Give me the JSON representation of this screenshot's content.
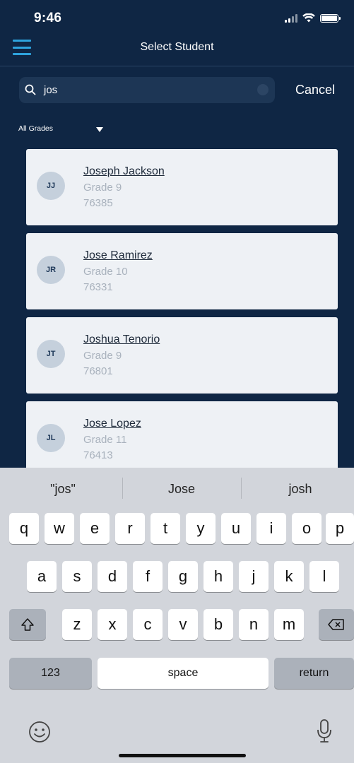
{
  "status_bar": {
    "time": "9:46"
  },
  "nav": {
    "title": "Select Student"
  },
  "search": {
    "value": "jos",
    "cancel_label": "Cancel"
  },
  "filter": {
    "label": "All Grades"
  },
  "students": [
    {
      "initials": "JJ",
      "name": "Joseph Jackson",
      "grade": "Grade 9",
      "id": "76385"
    },
    {
      "initials": "JR",
      "name": "Jose Ramirez",
      "grade": "Grade 10",
      "id": "76331"
    },
    {
      "initials": "JT",
      "name": "Joshua Tenorio",
      "grade": "Grade 9",
      "id": "76801"
    },
    {
      "initials": "JL",
      "name": "Jose Lopez",
      "grade": "Grade 11",
      "id": "76413"
    }
  ],
  "keyboard": {
    "suggestions": [
      "\"jos\"",
      "Jose",
      "josh"
    ],
    "row1": [
      "q",
      "w",
      "e",
      "r",
      "t",
      "y",
      "u",
      "i",
      "o",
      "p"
    ],
    "row2": [
      "a",
      "s",
      "d",
      "f",
      "g",
      "h",
      "j",
      "k",
      "l"
    ],
    "row3": [
      "z",
      "x",
      "c",
      "v",
      "b",
      "n",
      "m"
    ],
    "numbers_label": "123",
    "space_label": "space",
    "return_label": "return"
  },
  "colors": {
    "background": "#0f2644",
    "accent": "#2ea3dd",
    "card": "#eef1f5"
  }
}
